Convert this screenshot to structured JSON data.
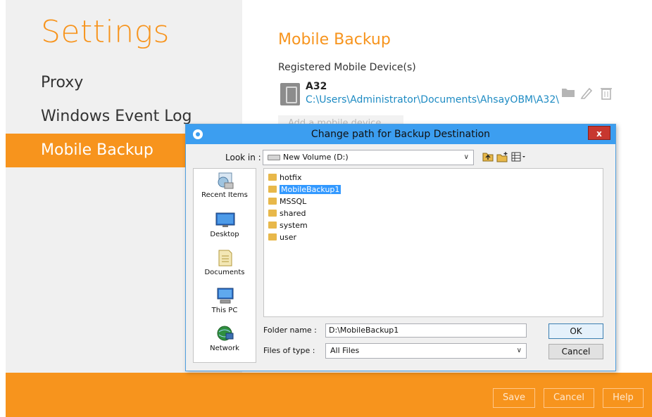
{
  "sidebar": {
    "title": "Settings",
    "items": [
      {
        "label": "Proxy",
        "active": false
      },
      {
        "label": "Windows Event Log",
        "active": false
      },
      {
        "label": "Mobile Backup",
        "active": true
      }
    ]
  },
  "content": {
    "title": "Mobile Backup",
    "registered_label": "Registered Mobile Device(s)",
    "device": {
      "name": "A32",
      "path": "C:\\Users\\Administrator\\Documents\\AhsayOBM\\A32\\..."
    },
    "actions": [
      "folder-icon",
      "edit-icon",
      "delete-icon"
    ],
    "add_device_label": "Add a mobile device"
  },
  "bottom_bar": {
    "save_label": "Save",
    "cancel_label": "Cancel",
    "help_label": "Help"
  },
  "dialog": {
    "title": "Change path for Backup Destination",
    "close_label": "x",
    "look_in_label": "Look in :",
    "look_in_value": "New Volume (D:)",
    "places": [
      {
        "label": "Recent Items",
        "icon": "recent-items-icon"
      },
      {
        "label": "Desktop",
        "icon": "desktop-icon"
      },
      {
        "label": "Documents",
        "icon": "documents-icon"
      },
      {
        "label": "This PC",
        "icon": "this-pc-icon"
      },
      {
        "label": "Network",
        "icon": "network-icon"
      }
    ],
    "files": [
      {
        "name": "hotfix",
        "selected": false
      },
      {
        "name": "MobileBackup1",
        "selected": true
      },
      {
        "name": "MSSQL",
        "selected": false
      },
      {
        "name": "shared",
        "selected": false
      },
      {
        "name": "system",
        "selected": false
      },
      {
        "name": "user",
        "selected": false
      }
    ],
    "folder_name_label": "Folder name :",
    "folder_name_value": "D:\\MobileBackup1",
    "files_of_type_label": "Files of type :",
    "files_of_type_value": "All Files",
    "ok_label": "OK",
    "cancel_label": "Cancel"
  },
  "colors": {
    "accent": "#f7941d",
    "link": "#1e8bc3",
    "titlebar": "#3c9ef0",
    "selection": "#3399ff"
  }
}
